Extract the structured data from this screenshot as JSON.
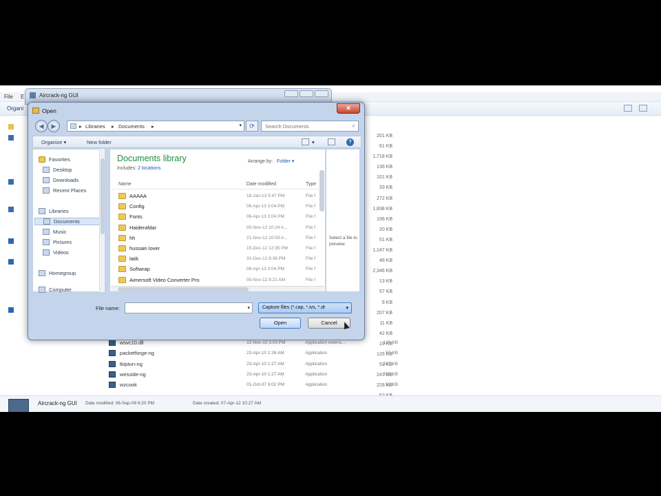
{
  "explorer": {
    "menu": [
      "File",
      "E"
    ],
    "toolbar_organize": "Organi",
    "sizes": [
      "201 KB",
      "61 KB",
      "1,718 KB",
      "136 KB",
      "101 KB",
      "33 KB",
      "272 KB",
      "1,838 KB",
      "106 KB",
      "20 KB",
      "51 KB",
      "1,147 KB",
      "46 KB",
      "2,346 KB",
      "13 KB",
      "57 KB",
      "6 KB",
      "207 KB",
      "11 KB",
      "42 KB",
      "19 KB",
      "126 KB",
      "52 KB",
      "247 KB",
      "228 KB",
      "52 KB"
    ],
    "rows": [
      {
        "name": "wsvc10.dll",
        "date": "12-Nov-10 3:03 PM",
        "type": "Application extens...",
        "size": "126 KB"
      },
      {
        "name": "packetforge-ng",
        "date": "23-Apr-10 1:26 AM",
        "type": "Application",
        "size": "52 KB"
      },
      {
        "name": "tkiptun-ng",
        "date": "23-Apr-10 1:27 AM",
        "type": "Application",
        "size": "247 KB"
      },
      {
        "name": "wesside-ng",
        "date": "23-Apr-10 1:27 AM",
        "type": "Application",
        "size": "228 KB"
      },
      {
        "name": "wzcook",
        "date": "01-Oct-07 9:02 PM",
        "type": "Application",
        "size": "52 KB"
      }
    ],
    "status": {
      "name": "Aircrack-ng GUI",
      "modified": "Date modified: 06-Sep-09 6:20 PM",
      "created": "Date created: 07-Apr-12 10:27 AM"
    }
  },
  "aircrack_window": {
    "title": "Aircrack-ng GUI"
  },
  "dialog": {
    "title": "Open",
    "close_glyph": "✕",
    "address": {
      "crumbs": [
        "Libraries",
        "Documents"
      ]
    },
    "search": {
      "placeholder": "Search Documents"
    },
    "commands": {
      "organize": "Organize ▾",
      "new_folder": "New folder"
    },
    "nav": {
      "favorites": "Favorites",
      "desktop": "Desktop",
      "downloads": "Downloads",
      "recent": "Recent Places",
      "libraries": "Libraries",
      "documents": "Documents",
      "music": "Music",
      "pictures": "Pictures",
      "videos": "Videos",
      "homegroup": "Homegroup",
      "computer": "Computer"
    },
    "library": {
      "title": "Documents library",
      "includes_label": "Includes:",
      "includes_link": "2 locations",
      "arrange_label": "Arrange by:",
      "arrange_value": "Folder ▾"
    },
    "columns": {
      "name": "Name",
      "date": "Date modified",
      "type": "Type"
    },
    "files": [
      {
        "name": "AAAAA",
        "date": "18-Jan-13 5:47 PM",
        "type": "File f"
      },
      {
        "name": "Config",
        "date": "06-Apr-13 3:04 PM",
        "type": "File f"
      },
      {
        "name": "Fonts",
        "date": "06-Apr-13 3:04 PM",
        "type": "File f"
      },
      {
        "name": "Haiderafdar",
        "date": "05-Nov-12 10:24 A...",
        "type": "File f"
      },
      {
        "name": "hh",
        "date": "21-Nov-12 10:03 A...",
        "type": "File f"
      },
      {
        "name": "hussain lover",
        "date": "15-Dec-12 12:35 PM",
        "type": "File f"
      },
      {
        "name": "latik",
        "date": "31-Dec-12 8:38 PM",
        "type": "File f"
      },
      {
        "name": "Softwrap",
        "date": "06-Apr-13 3:04 PM",
        "type": "File f"
      },
      {
        "name": "Aimersoft Video Converter Pro",
        "date": "05-Nov-12 8:21 AM",
        "type": "File f"
      }
    ],
    "preview_text": "Select a file to preview.",
    "filename": {
      "label": "File name:",
      "value": ""
    },
    "filter": {
      "label": "Capture files (*.cap, *.ivs, *.dr"
    },
    "open_label": "Open",
    "cancel_label": "Cancel"
  }
}
